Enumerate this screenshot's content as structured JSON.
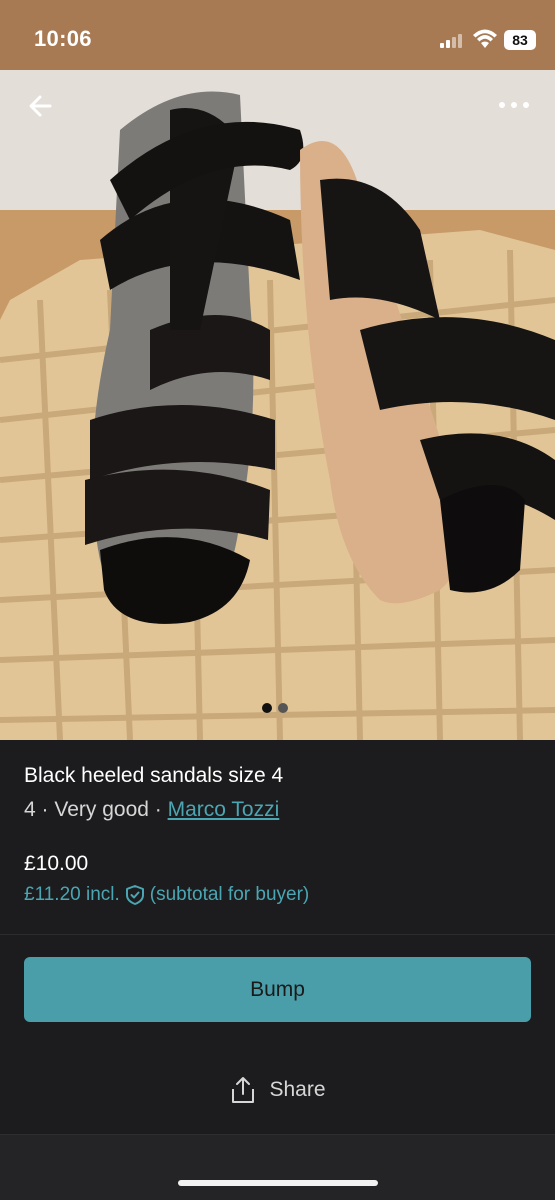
{
  "status_bar": {
    "time": "10:06",
    "battery": "83"
  },
  "listing": {
    "title": "Black heeled sandals size 4",
    "size": "4",
    "separator": "·",
    "condition": "Very good",
    "brand": "Marco Tozzi",
    "price": "£10.00",
    "price_incl": "£11.20 incl.",
    "incl_note": "(subtotal for buyer)",
    "photo_count": 2,
    "active_photo": 1
  },
  "actions": {
    "bump_label": "Bump",
    "share_label": "Share"
  },
  "icons": {
    "back": "back-arrow-icon",
    "more": "more-dots-icon",
    "buyer_protection": "shield-check-icon",
    "share": "share-icon"
  },
  "colors": {
    "accent": "#4a9ea9",
    "link": "#4aa6b2",
    "background": "#1c1c1e"
  }
}
